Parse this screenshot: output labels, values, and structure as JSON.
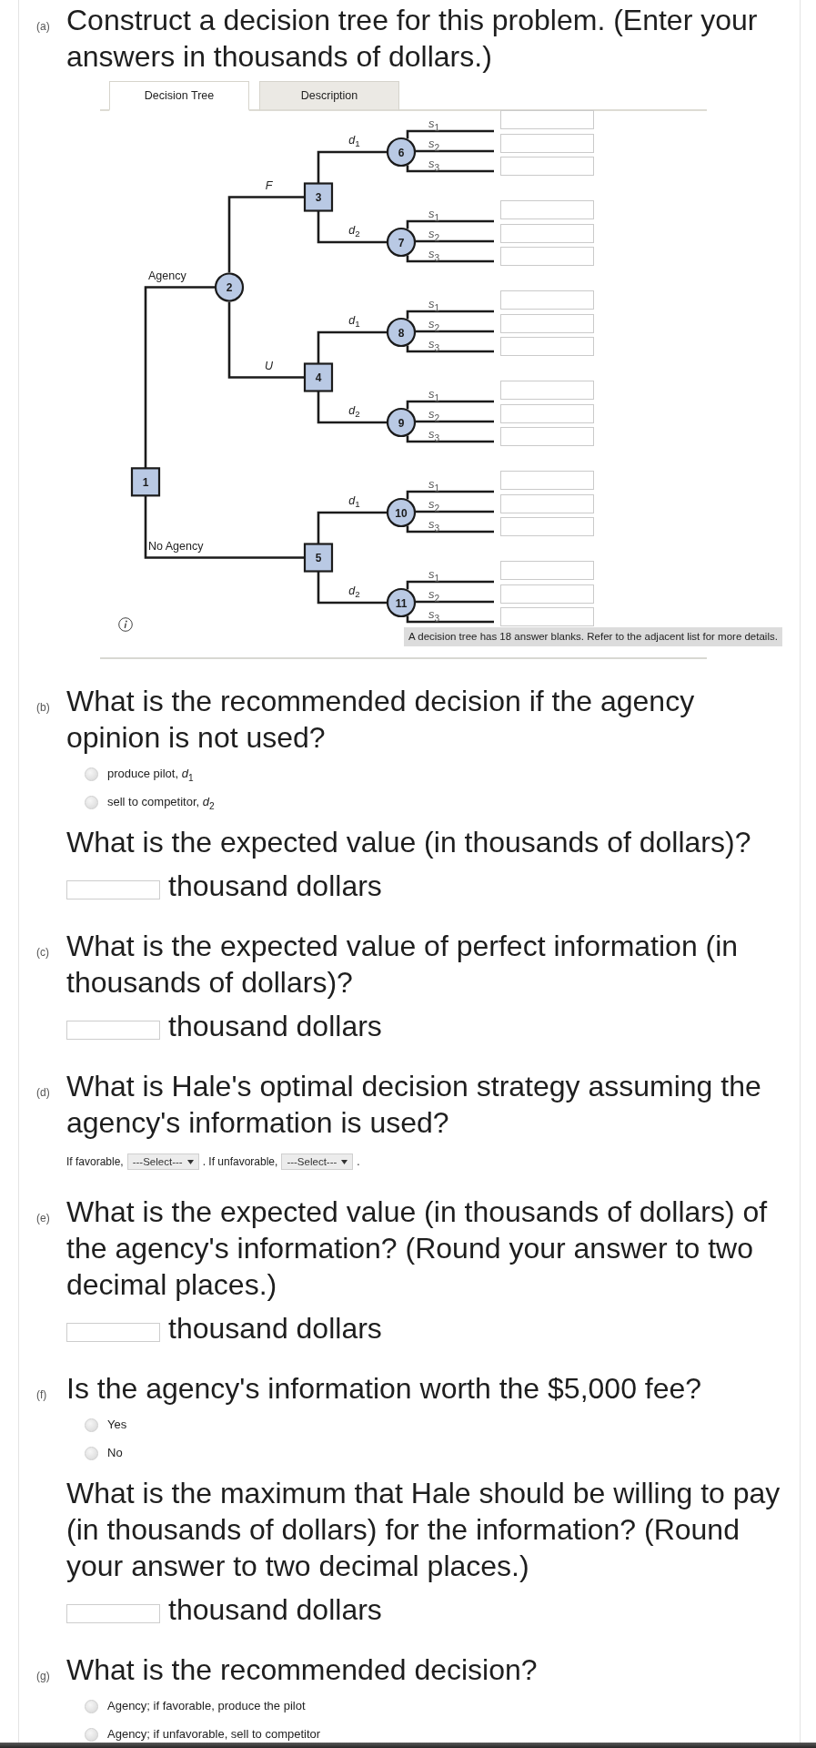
{
  "parts": [
    {
      "label": "(a)",
      "items": [
        {
          "kind": "question",
          "text": "Construct a decision tree for this problem. (Enter your answers in thousands of dollars.)"
        },
        {
          "kind": "tree_widget",
          "tabs": [
            {
              "label": "Decision Tree",
              "selected": true
            },
            {
              "label": "Description",
              "selected": false
            }
          ],
          "tree": {
            "kind": "decision",
            "number": "1",
            "branches": [
              {
                "label": "Agency",
                "node": {
                  "kind": "chance",
                  "number": "2",
                  "branches": [
                    {
                      "label": "F",
                      "node": {
                        "kind": "decision",
                        "number": "3",
                        "branches": [
                          {
                            "label": "*d*$_{1}$",
                            "node": {
                              "kind": "chance",
                              "number": "6",
                              "outcomes": [
                                "*s*$_{1}$",
                                "*s*$_{2}$",
                                "*s*$_{3}$"
                              ]
                            }
                          },
                          {
                            "label": "*d*$_{2}$",
                            "node": {
                              "kind": "chance",
                              "number": "7",
                              "outcomes": [
                                "*s*$_{1}$",
                                "*s*$_{2}$",
                                "*s*$_{3}$"
                              ]
                            }
                          }
                        ]
                      }
                    },
                    {
                      "label": "U",
                      "node": {
                        "kind": "decision",
                        "number": "4",
                        "branches": [
                          {
                            "label": "*d*$_{1}$",
                            "node": {
                              "kind": "chance",
                              "number": "8",
                              "outcomes": [
                                "*s*$_{1}$",
                                "*s*$_{2}$",
                                "*s*$_{3}$"
                              ]
                            }
                          },
                          {
                            "label": "*d*$_{2}$",
                            "node": {
                              "kind": "chance",
                              "number": "9",
                              "outcomes": [
                                "*s*$_{1}$",
                                "*s*$_{2}$",
                                "*s*$_{3}$"
                              ]
                            }
                          }
                        ]
                      }
                    }
                  ]
                }
              },
              {
                "label": "No Agency",
                "node": {
                  "kind": "decision",
                  "number": "5",
                  "branches": [
                    {
                      "label": "*d*$_{1}$",
                      "node": {
                        "kind": "chance",
                        "number": "10",
                        "outcomes": [
                          "*s*$_{1}$",
                          "*s*$_{2}$",
                          "*s*$_{3}$"
                        ]
                      }
                    },
                    {
                      "label": "*d*$_{2}$",
                      "node": {
                        "kind": "chance",
                        "number": "11",
                        "outcomes": [
                          "*s*$_{1}$",
                          "*s*$_{2}$",
                          "*s*$_{3}$"
                        ]
                      }
                    }
                  ]
                }
              }
            ]
          },
          "note": "A decision tree has 18 answer blanks. Refer to the adjacent list for more details."
        }
      ]
    },
    {
      "label": "(b)",
      "items": [
        {
          "kind": "question",
          "text": "What is the recommended decision if the agency opinion is not used?"
        },
        {
          "kind": "choices",
          "options": [
            {
              "label": "produce pilot, *d*$_{1}$",
              "selected": false
            },
            {
              "label": "sell to competitor, *d*$_{2}$",
              "selected": false
            }
          ]
        },
        {
          "kind": "question",
          "text": "What is the expected value (in thousands of dollars)?"
        },
        {
          "kind": "answer",
          "unit": "thousand dollars"
        }
      ]
    },
    {
      "label": "(c)",
      "items": [
        {
          "kind": "question",
          "text": "What is the expected value of perfect information (in thousands of dollars)?"
        },
        {
          "kind": "answer",
          "unit": "thousand dollars"
        }
      ]
    },
    {
      "label": "(d)",
      "items": [
        {
          "kind": "question",
          "text": "What is Hale's optimal decision strategy assuming the agency's information is used?"
        },
        {
          "kind": "inline",
          "segments": [
            {
              "kind": "text",
              "text": "If favorable,"
            },
            {
              "kind": "select",
              "value": "---Select---"
            },
            {
              "kind": "text",
              "text": ". If unfavorable,"
            },
            {
              "kind": "select",
              "value": "---Select---"
            },
            {
              "kind": "text",
              "text": "."
            }
          ]
        }
      ]
    },
    {
      "label": "(e)",
      "items": [
        {
          "kind": "question",
          "text": "What is the expected value (in thousands of dollars) of the agency's information? (Round your answer to two decimal places.)"
        },
        {
          "kind": "answer",
          "unit": "thousand dollars"
        }
      ]
    },
    {
      "label": "(f)",
      "items": [
        {
          "kind": "question",
          "text": "Is the agency's information worth the $5,000 fee?"
        },
        {
          "kind": "choices",
          "options": [
            {
              "label": "Yes",
              "selected": false
            },
            {
              "label": "No",
              "selected": false
            }
          ]
        },
        {
          "kind": "question",
          "text": "What is the maximum that Hale should be willing to pay (in thousands of dollars) for the information? (Round your answer to two decimal places.)"
        },
        {
          "kind": "answer",
          "unit": "thousand dollars"
        }
      ]
    },
    {
      "label": "(g)",
      "items": [
        {
          "kind": "question",
          "text": "What is the recommended decision?"
        },
        {
          "kind": "choices",
          "options": [
            {
              "label": "Agency; if favorable, produce the pilot",
              "selected": false
            },
            {
              "label": "Agency; if unfavorable, sell to competitor",
              "selected": false
            }
          ]
        }
      ]
    }
  ]
}
